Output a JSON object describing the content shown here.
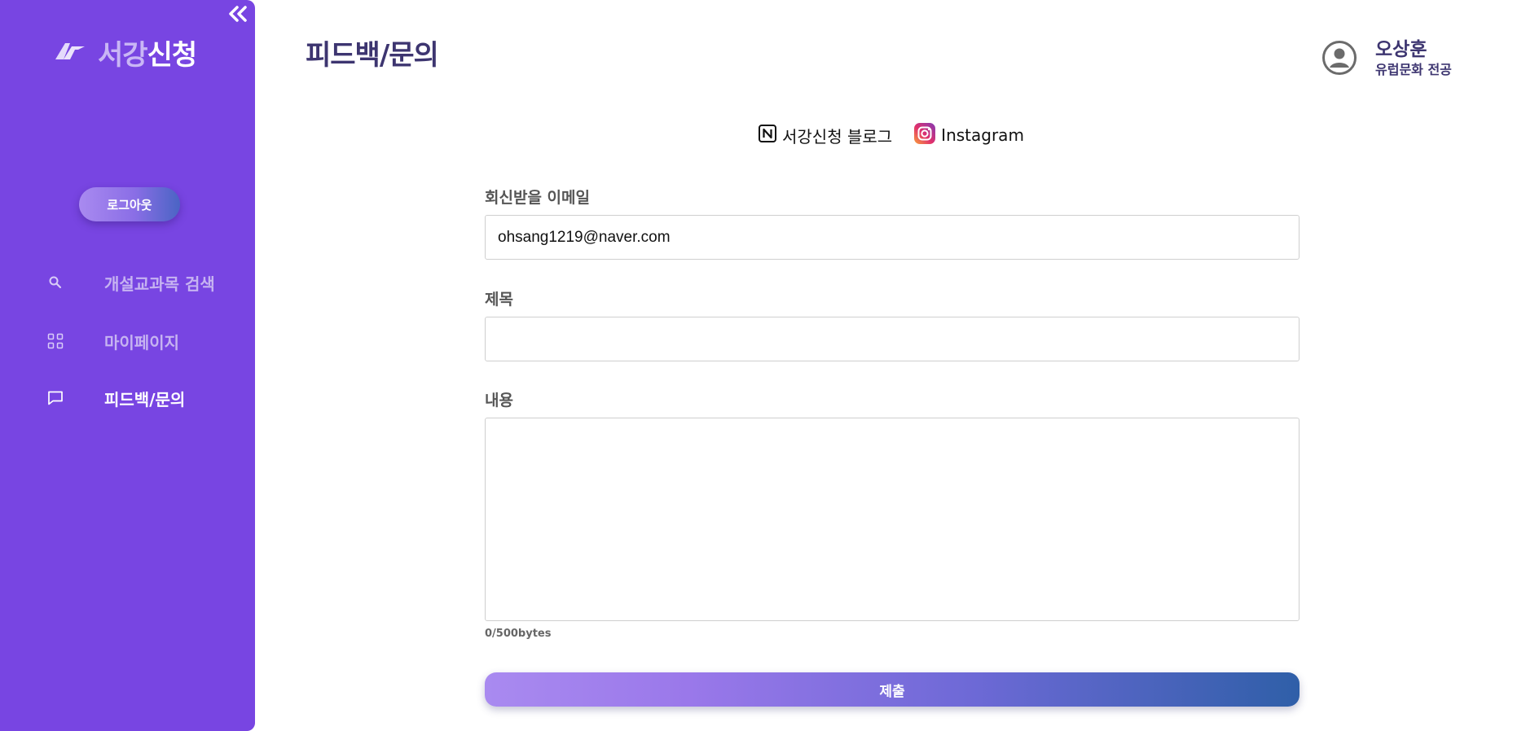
{
  "colors": {
    "sidebar_bg": "#7845e2",
    "title_text": "#3d3570",
    "submit_gradient_start": "#a98af0",
    "submit_gradient_end": "#2f5fa8"
  },
  "sidebar": {
    "collapse_icon": "double-chevron-left-icon",
    "logo": {
      "icon": "sogang-logo-icon",
      "text_light": "서강",
      "text_strong": "신청"
    },
    "logout_label": "로그아웃",
    "items": [
      {
        "icon": "search-icon",
        "label": "개설교과목 검색",
        "active": false
      },
      {
        "icon": "grid-icon",
        "label": "마이페이지",
        "active": false
      },
      {
        "icon": "message-icon",
        "label": "피드백/문의",
        "active": true
      }
    ]
  },
  "header": {
    "title": "피드백/문의",
    "user": {
      "icon": "user-circle-icon",
      "name": "오상훈",
      "major": "유럽문화 전공"
    }
  },
  "links": [
    {
      "icon": "notion-icon",
      "label": "서강신청 블로그"
    },
    {
      "icon": "instagram-icon",
      "label": "Instagram"
    }
  ],
  "form": {
    "email_label": "회신받을 이메일",
    "email_value": "ohsang1219@naver.com",
    "subject_label": "제목",
    "subject_value": "",
    "content_label": "내용",
    "content_value": "",
    "byte_counter": "0/500bytes",
    "submit_label": "제출"
  }
}
